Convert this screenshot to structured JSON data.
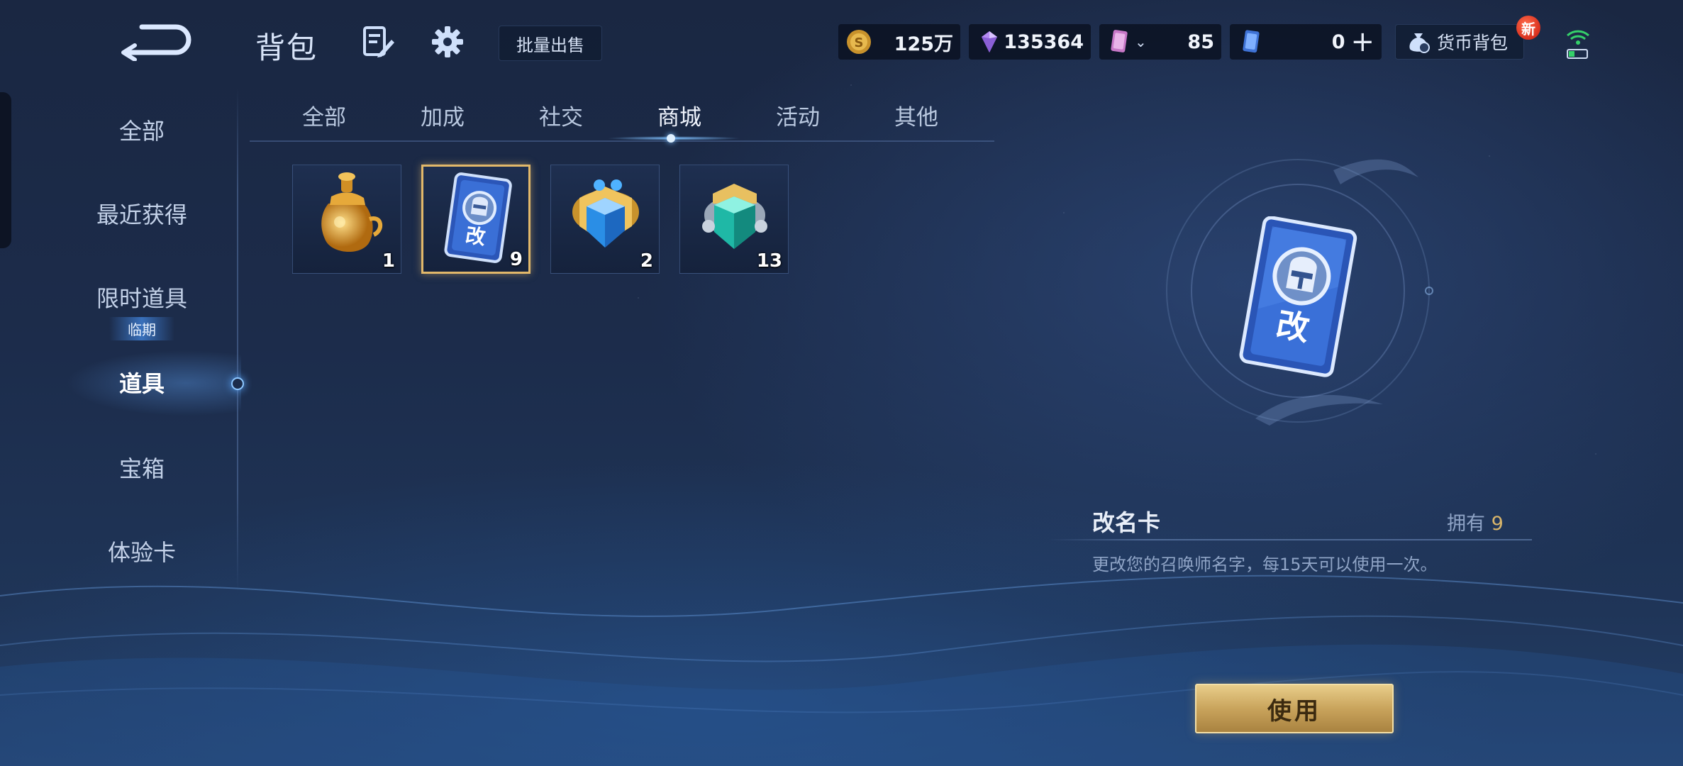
{
  "header": {
    "title": "背包",
    "bulk_sell_label": "批量出售",
    "currencies": [
      {
        "icon": "gold-coin-icon",
        "value": "125万"
      },
      {
        "icon": "diamond-icon",
        "value": "135364"
      },
      {
        "icon": "hero-card-icon",
        "value": "85"
      },
      {
        "icon": "blue-card-icon",
        "value": "0"
      }
    ],
    "wallet_label": "货币背包",
    "new_badge": "新"
  },
  "sidebar": {
    "items": [
      {
        "label": "全部"
      },
      {
        "label": "最近获得"
      },
      {
        "label": "限时道具",
        "tag": "临期"
      },
      {
        "label": "道具",
        "active": true
      },
      {
        "label": "宝箱"
      },
      {
        "label": "体验卡"
      }
    ]
  },
  "tabs": [
    {
      "label": "全部"
    },
    {
      "label": "加成"
    },
    {
      "label": "社交"
    },
    {
      "label": "商城",
      "active": true
    },
    {
      "label": "活动"
    },
    {
      "label": "其他"
    }
  ],
  "inventory": [
    {
      "icon": "golden-potion-icon",
      "qty": "1"
    },
    {
      "icon": "rename-card-icon",
      "qty": "9",
      "selected": true
    },
    {
      "icon": "blue-gem-icon",
      "qty": "2"
    },
    {
      "icon": "teal-gem-icon",
      "qty": "13"
    }
  ],
  "detail": {
    "card_glyph": "改",
    "name": "改名卡",
    "own_label": "拥有",
    "own_count": "9",
    "description": "更改您的召唤师名字，每15天可以使用一次。",
    "use_label": "使用"
  },
  "colors": {
    "accent_gold": "#e2b86a",
    "tab_glow": "#7fc0ff",
    "new_badge": "#d62a18"
  }
}
